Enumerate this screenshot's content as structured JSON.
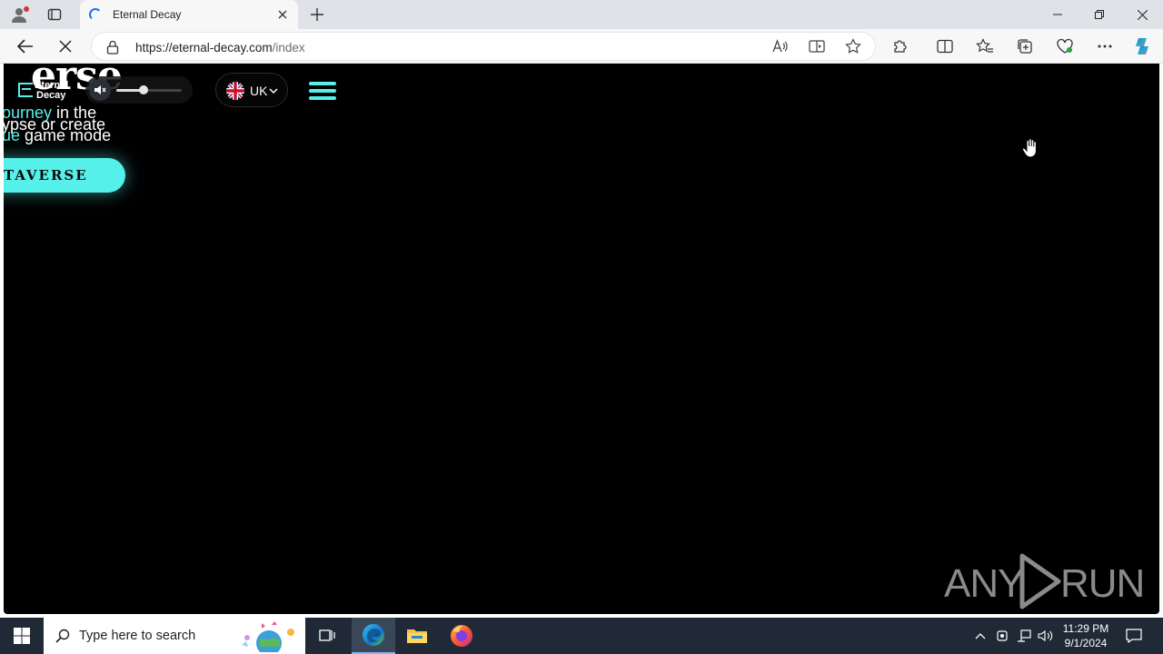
{
  "browser": {
    "tab_title": "Eternal Decay",
    "url_host": "https://eternal-decay.com",
    "url_path": "/index"
  },
  "page": {
    "hero_word": "erse",
    "logo_line1": "Eternal",
    "logo_line2": "Decay",
    "volume_level": 0.42,
    "language_code": "UK",
    "tagline_line1_accent": "ourney",
    "tagline_line1_rest": " in the",
    "tagline_line2": "ypse or create",
    "tagline_line3_accent": "ue",
    "tagline_line3_rest": " game mode",
    "cta_label": "TAVERSE",
    "accent_color": "#56f0ea"
  },
  "watermark": {
    "left": "ANY",
    "right": "RUN"
  },
  "taskbar": {
    "search_placeholder": "Type here to search",
    "time": "11:29 PM",
    "date": "9/1/2024",
    "apps": [
      "task-view-icon",
      "edge-icon",
      "file-explorer-icon",
      "firefox-icon"
    ]
  }
}
